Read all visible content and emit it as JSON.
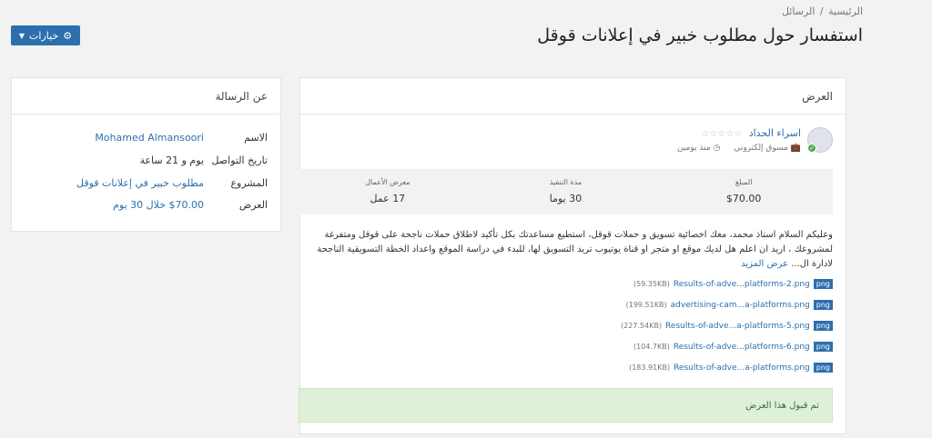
{
  "breadcrumb": {
    "home": "الرئيسية",
    "sep": "/",
    "current": "الرسائل"
  },
  "page_title": "استفسار حول مطلوب خبير في إعلانات قوقل",
  "options_button": {
    "label": "خيارات"
  },
  "offer_panel": {
    "header": "العرض",
    "bidder": {
      "name": "اسراء الحداد",
      "stars": "☆☆☆☆☆",
      "role": "مسوق إلكتروني",
      "time": "منذ يومين"
    },
    "stats": [
      {
        "label": "المبلغ",
        "value": "$70.00"
      },
      {
        "label": "مدة التنفيذ",
        "value": "30 يوما"
      },
      {
        "label": "معرض الأعمال",
        "value": "17 عمل"
      }
    ],
    "description": "وعليكم السلام استاذ محمد، معك اخصائية تسويق و حملات قوقل، استطيع مساعدتك بكل تأكيد لاطلاق حملات ناجحة على قوقل ومتفرغة لمشروعك ، اريد ان اعلم هل لديك موقع او متجر او قناة يوتيوب تريد التسويق لها، للبدء في دراسة الموقع واعداد الخطة التسويقية الناجحة لادارة ال...",
    "more_link": "عرض المزيد",
    "files": [
      {
        "type": "png",
        "name": "Results-of-adve...platforms-2.png",
        "size": "(59.35KB)"
      },
      {
        "type": "png",
        "name": "advertising-cam...a-platforms.png",
        "size": "(199.51KB)"
      },
      {
        "type": "png",
        "name": "Results-of-adve...a-platforms-5.png",
        "size": "(227.54KB)"
      },
      {
        "type": "png",
        "name": "Results-of-adve...platforms-6.png",
        "size": "(104.7KB)"
      },
      {
        "type": "png",
        "name": "Results-of-adve...a-platforms.png",
        "size": "(183.91KB)"
      }
    ],
    "accepted_notice": "تم قبول هذا العرض"
  },
  "message_panel": {
    "header": "عن الرسالة",
    "rows": [
      {
        "key": "الاسم",
        "value": "Mohamed Almansoori"
      },
      {
        "key": "تاريخ التواصل",
        "value": "يوم و 21 ساعة"
      },
      {
        "key": "المشروع",
        "value": "مطلوب خبير في إعلانات قوقل"
      },
      {
        "key": "العرض",
        "value": "$70.00 خلال 30 يوم"
      }
    ]
  },
  "colors": {
    "accent": "#2c6fad",
    "success_bg": "#dff0d8",
    "background": "#f2f2f2"
  }
}
